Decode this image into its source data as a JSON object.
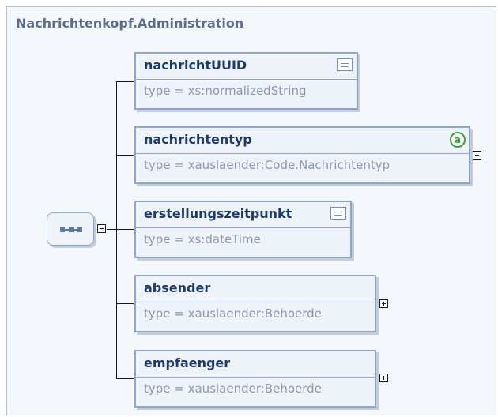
{
  "diagram": {
    "title": "Nachrichtenkopf.Administration",
    "compositor": "sequence",
    "elements": [
      {
        "name": "nachrichtUUID",
        "type": "type = xs:normalizedString",
        "icon": "documentation-icon",
        "expandable": false
      },
      {
        "name": "nachrichtentyp",
        "type": "type = xauslaender:Code.Nachrichtentyp",
        "icon": "attributes-icon",
        "icon_text": "a",
        "expandable": true
      },
      {
        "name": "erstellungszeitpunkt",
        "type": "type = xs:dateTime",
        "icon": "documentation-icon",
        "expandable": false
      },
      {
        "name": "absender",
        "type": "type = xauslaender:Behoerde",
        "expandable": true
      },
      {
        "name": "empfaenger",
        "type": "type = xauslaender:Behoerde",
        "expandable": true
      }
    ]
  },
  "colors": {
    "title": "#5b6f8c",
    "node_border": "#8ea5c6",
    "node_fill": "#eef3fa",
    "node_name": "#1f3a68",
    "node_type": "#8a98ae",
    "attribute_icon": "#3aa23a"
  }
}
